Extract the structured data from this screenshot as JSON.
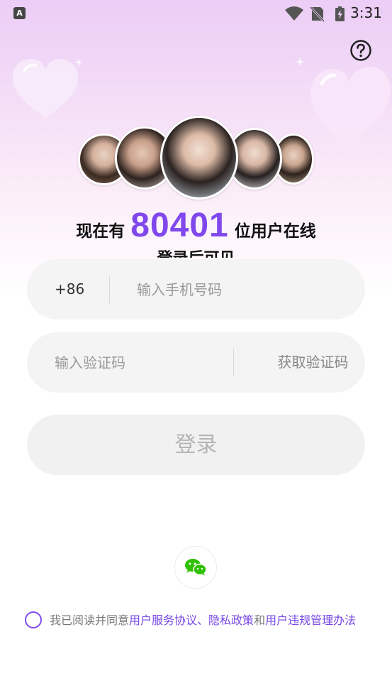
{
  "status_bar": {
    "time": "3:31",
    "app_icon_letter": "A"
  },
  "headline": {
    "prefix": "现在有",
    "count": "80401",
    "suffix": "位用户在线"
  },
  "subline": "登录后可见",
  "phone": {
    "country_code": "+86",
    "placeholder": "输入手机号码"
  },
  "code": {
    "placeholder": "输入验证码",
    "get_code_label": "获取验证码"
  },
  "login_label": "登录",
  "agreement": {
    "prefix": "我已阅读并同意",
    "terms": "用户服务协议",
    "sep": "、",
    "privacy": "隐私政策",
    "and": "和",
    "rules": "用户违规管理办法"
  },
  "icons": [
    "help-icon",
    "wechat-icon",
    "wifi-icon",
    "no-sim-icon",
    "battery-charging-icon"
  ],
  "colors": {
    "accent": "#8048ec",
    "link": "#7748e6",
    "wechat": "#2dc100"
  }
}
